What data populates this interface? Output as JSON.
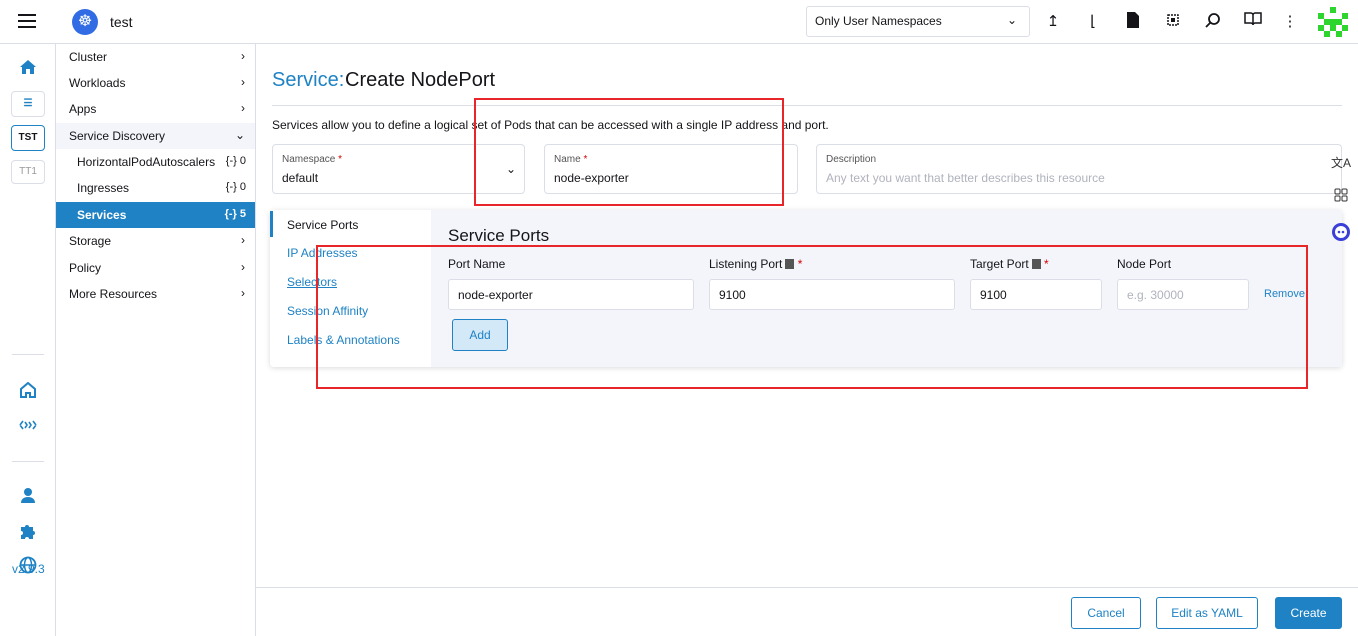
{
  "header": {
    "cluster_name": "test",
    "namespace_filter": "Only User Namespaces",
    "icons": [
      "import-yaml-icon",
      "kubectl-shell-icon",
      "kubeconfig-icon",
      "copy-kubeconfig-icon",
      "search-icon",
      "docs-icon",
      "more-icon"
    ]
  },
  "rail": {
    "items": [
      {
        "name": "home-icon"
      },
      {
        "name": "cluster-tst",
        "label": "TST"
      },
      {
        "name": "cluster-tt1",
        "label": "TT1"
      },
      {
        "name": "fleet-icon"
      },
      {
        "name": "cluster-management-icon"
      },
      {
        "name": "users-icon"
      },
      {
        "name": "extensions-icon"
      },
      {
        "name": "global-settings-icon"
      }
    ],
    "version": "v2.9.3"
  },
  "sidenav": {
    "cluster": "Cluster",
    "workloads": "Workloads",
    "apps": "Apps",
    "service_discovery": "Service Discovery",
    "hpa": "HorizontalPodAutoscalers",
    "hpa_count": "0",
    "ingresses": "Ingresses",
    "ingresses_count": "0",
    "services": "Services",
    "services_count": "5",
    "storage": "Storage",
    "policy": "Policy",
    "more_resources": "More Resources"
  },
  "page": {
    "title_prefix": "Service:",
    "title": "Create NodePort",
    "description": "Services allow you to define a logical set of Pods that can be accessed with a single IP address and port.",
    "namespace_label": "Namespace",
    "namespace_value": "default",
    "name_label": "Name",
    "name_value": "node-exporter",
    "description_label": "Description",
    "description_placeholder": "Any text you want that better describes this resource"
  },
  "tabs": [
    "Service Ports",
    "IP Addresses",
    "Selectors",
    "Session Affinity",
    "Labels & Annotations"
  ],
  "service_ports": {
    "title": "Service Ports",
    "col_port_name": "Port Name",
    "col_listening_port": "Listening Port",
    "col_target_port": "Target Port",
    "col_node_port": "Node Port",
    "port_name": "node-exporter",
    "listening_port": "9100",
    "target_port": "9100",
    "node_port_placeholder": "e.g. 30000",
    "remove_label": "Remove",
    "add_label": "Add"
  },
  "footer": {
    "cancel": "Cancel",
    "edit_yaml": "Edit as YAML",
    "create": "Create"
  },
  "colors": {
    "accent": "#1e82c4",
    "annotation_red": "#e8262a"
  }
}
